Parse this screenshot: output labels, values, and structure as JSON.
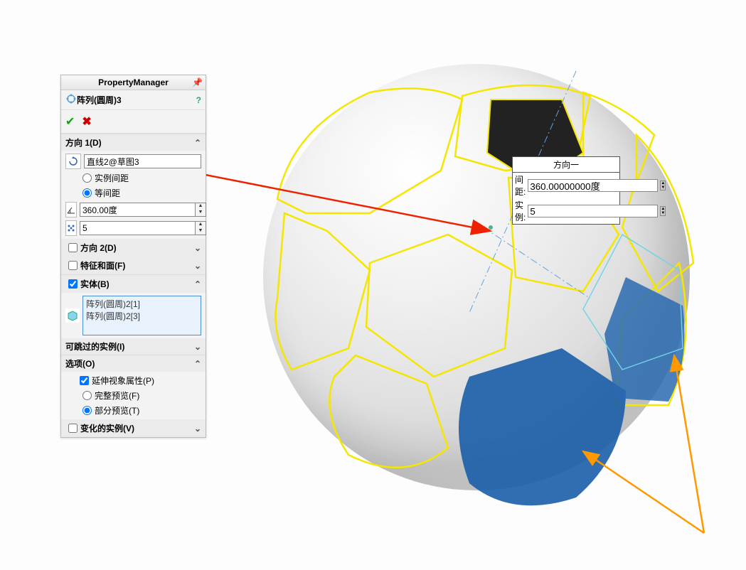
{
  "panel": {
    "title": "PropertyManager",
    "feature_name": "阵列(圆周)3",
    "direction1": {
      "title": "方向 1(D)",
      "axis_value": "直线2@草图3",
      "radio_instance_spacing": "实例间距",
      "radio_equal_spacing": "等间距",
      "angle": "360.00度",
      "count": "5"
    },
    "direction2": {
      "title": "方向 2(D)"
    },
    "features_faces": {
      "title": "特征和面(F)"
    },
    "bodies": {
      "title": "实体(B)",
      "items": [
        "阵列(圆周)2[1]",
        "阵列(圆周)2[3]"
      ]
    },
    "skippable": {
      "title": "可跳过的实例(I)"
    },
    "options": {
      "title": "选项(O)",
      "extend_visual": "延伸视象属性(P)",
      "full_preview": "完整预览(F)",
      "partial_preview": "部分预览(T)"
    },
    "varied": {
      "title": "变化的实例(V)"
    }
  },
  "floatbox": {
    "title": "方向一",
    "spacing_label": "间距:",
    "spacing_value": "360.00000000度",
    "instance_label": "实例:",
    "instance_value": "5"
  }
}
